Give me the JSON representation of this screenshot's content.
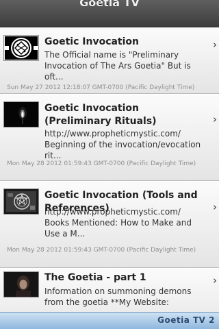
{
  "header": {
    "title": "Goetia TV"
  },
  "items": [
    {
      "title": "Goetic Invocation",
      "description": "The Official name is \"Preliminary Invocation of The Ars Goetia\" But is oft...",
      "date": "Sun May 27 2012 12:18:07 GMT-0700 (Pacific Daylight Time)",
      "thumbnail_icon": "sigil-thumbnail"
    },
    {
      "title": "Goetic Invocation (Preliminary Rituals)",
      "description": "http://www.propheticmystic.com/\nBeginning of the invocation/evocation rit...",
      "date": "Mon May 28 2012 01:59:43 GMT-0700 (Pacific Daylight Time)",
      "thumbnail_icon": "candle-thumbnail"
    },
    {
      "title": "Goetic Invocation (Tools and References)",
      "description": "http://www.propheticmystic.com/\nBooks Mentioned: How to Make and Use a M...",
      "date": "Mon May 28 2012 01:59:43 GMT-0700 (Pacific Daylight Time)",
      "thumbnail_icon": "circle-diagram-thumbnail"
    },
    {
      "title": "The Goetia - part 1",
      "description": "Information on summoning demons from the goetia **My Website:",
      "date": "",
      "thumbnail_icon": "person-thumbnail"
    }
  ],
  "footer": {
    "link_label": "Goetia TV 2"
  },
  "colors": {
    "header_bg": "#4a4a4a",
    "footer_bg": "#a9c9e8",
    "footer_text": "#2c4b73"
  }
}
